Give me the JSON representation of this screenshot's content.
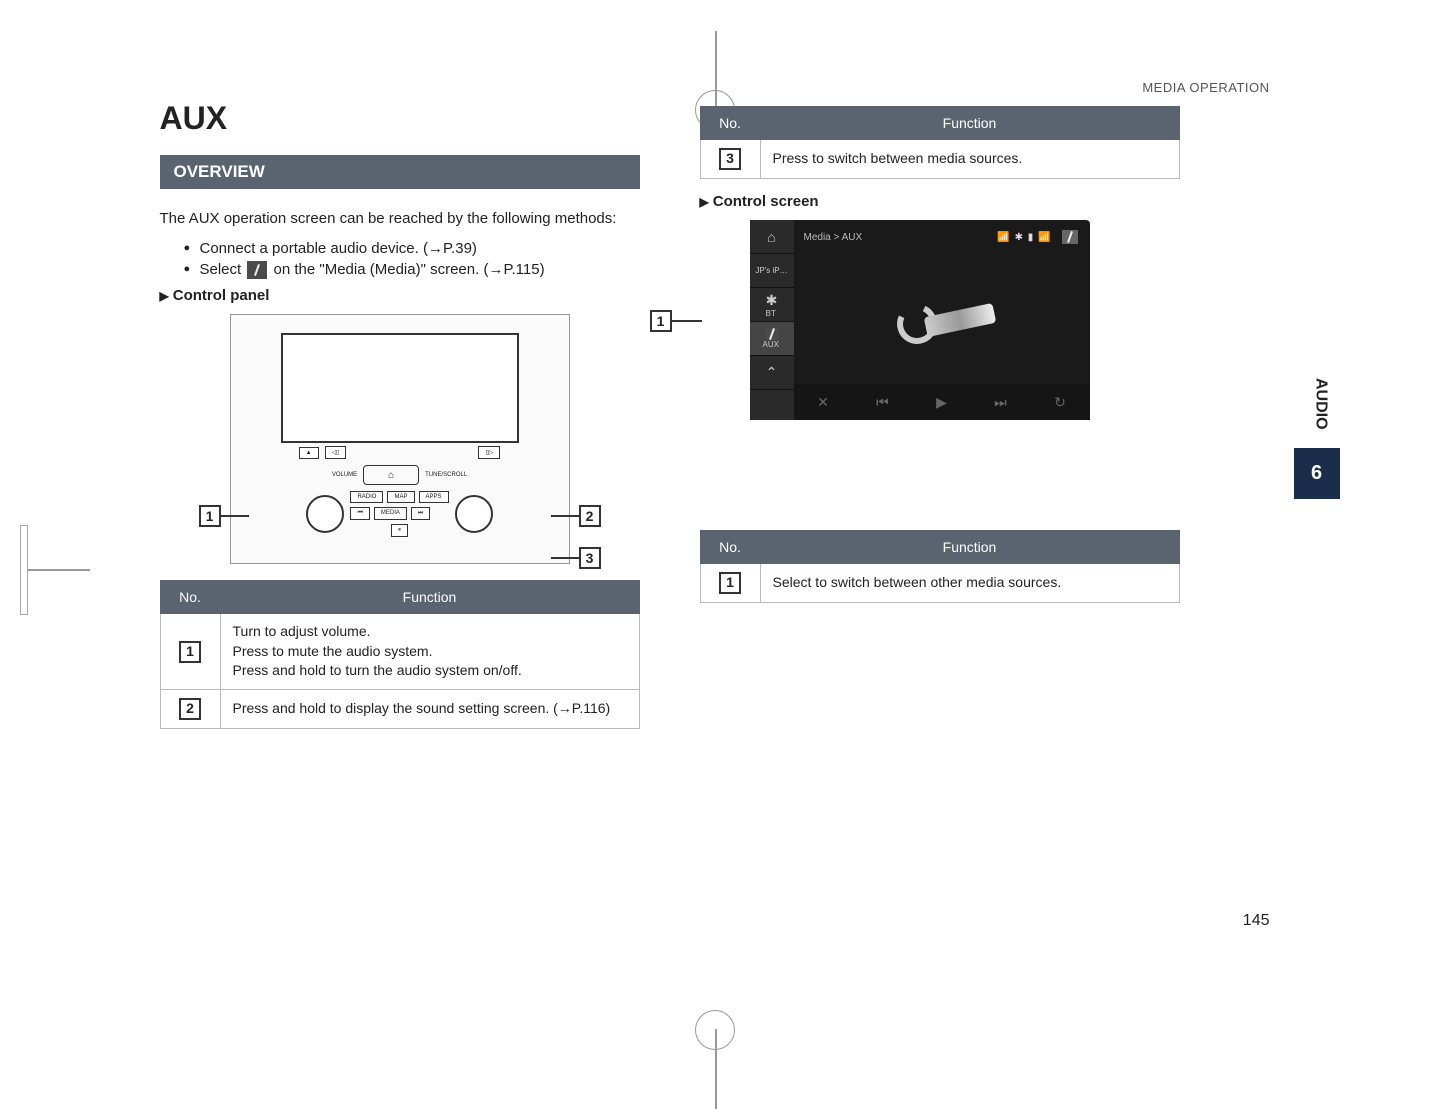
{
  "header": {
    "section": "MEDIA OPERATION"
  },
  "title": "AUX",
  "overview_bar": "OVERVIEW",
  "intro": "The AUX operation screen can be reached by the following methods:",
  "bullets": {
    "li1_pre": "Connect a portable audio device. (",
    "li1_ref": "→P.39",
    "li1_post": ")",
    "li2_pre": "Select ",
    "li2_mid": " on the \"Media (Media)\" screen. (",
    "li2_ref": "→P.115",
    "li2_post": ")"
  },
  "control_panel_heading": "Control panel",
  "control_screen_heading": "Control screen",
  "diagram": {
    "buttons": {
      "radio": "RADIO",
      "map": "MAP",
      "apps": "APPS",
      "media": "MEDIA",
      "prev": "⏮",
      "next": "⏭",
      "pause": "⏸",
      "home": "⌂",
      "vol": "VOLUME",
      "tune": "TUNE/SCROLL"
    },
    "callouts": {
      "c1": "1",
      "c2": "2",
      "c3": "3"
    }
  },
  "table1": {
    "head_no": "No.",
    "head_fn": "Function",
    "r1_no": "1",
    "r1_fn": "Turn to adjust volume.\nPress to mute the audio system.\nPress and hold to turn the audio system on/off.",
    "r2_no": "2",
    "r2_fn": "Press and hold to display the sound setting screen. (→P.116)"
  },
  "table2_head_no": "No.",
  "table2_head_fn": "Function",
  "table2_r1_no": "3",
  "table2_r1_fn": "Press to switch between media sources.",
  "screenshot": {
    "breadcrumb": "Media > AUX",
    "status_icons": "📶 ✱ ▮ 📶",
    "side_home": "⌂",
    "side_jps": "JP's iP…",
    "side_bt": "BT",
    "side_aux": "AUX",
    "side_up": "⌃",
    "bot_mute": "✕",
    "bot_prev": "⏮",
    "bot_play": "▶",
    "bot_next": "⏭",
    "bot_repeat": "↻",
    "aux_tool_icon": "✎",
    "callout": "1"
  },
  "table3": {
    "head_no": "No.",
    "head_fn": "Function",
    "r1_no": "1",
    "r1_fn": "Select to switch between other media sources."
  },
  "side": {
    "label": "AUDIO",
    "num": "6"
  },
  "page_number": "145"
}
